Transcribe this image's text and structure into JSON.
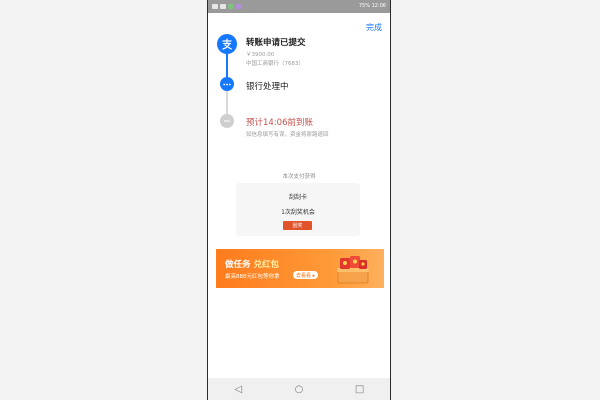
{
  "status": {
    "battery": "75%",
    "time": "12:06"
  },
  "header": {
    "done_label": "完成"
  },
  "steps": [
    {
      "title": "转账申请已提交",
      "amount": "￥3900.00",
      "bank": "中国工商银行（7683）"
    },
    {
      "title": "银行处理中"
    },
    {
      "title": "预计14:06前到账",
      "note": "如信息填写有误，资金将原路退回"
    }
  ],
  "reward": {
    "label": "本次支付获得",
    "card_title": "刮刮卡",
    "card_sub": "1次刮奖机会",
    "button": "刮奖"
  },
  "banner": {
    "title_part1": "做任务 ",
    "title_part2": "兑红包",
    "subtitle": "最高888元红包等你拿",
    "button": "去看看 ▸"
  },
  "icons": {
    "step1": "alipay-icon",
    "step2": "more-dots-icon",
    "step3": "pending-icon",
    "back": "back-icon",
    "home": "home-icon",
    "recent": "recent-apps-icon"
  },
  "colors": {
    "accent": "#1677ff",
    "warning": "#c4514d",
    "banner": "#ff7b1c"
  }
}
